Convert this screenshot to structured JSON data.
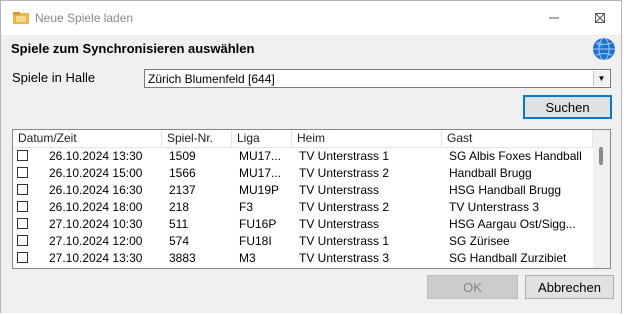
{
  "window": {
    "title": "Neue Spiele laden"
  },
  "heading": "Spiele zum Synchronisieren auswählen",
  "hall": {
    "label": "Spiele in Halle",
    "selected": "Zürich Blumenfeld [644]"
  },
  "buttons": {
    "search": "Suchen",
    "ok": "OK",
    "cancel": "Abbrechen"
  },
  "table": {
    "columns": [
      "Datum/Zeit",
      "Spiel-Nr.",
      "Liga",
      "Heim",
      "Gast"
    ],
    "rows": [
      {
        "checked": false,
        "datetime": "26.10.2024 13:30",
        "nr": "1509",
        "liga": "MU17...",
        "heim": "TV Unterstrass 1",
        "gast": "SG Albis Foxes Handball"
      },
      {
        "checked": false,
        "datetime": "26.10.2024 15:00",
        "nr": "1566",
        "liga": "MU17...",
        "heim": "TV Unterstrass 2",
        "gast": "Handball Brugg"
      },
      {
        "checked": false,
        "datetime": "26.10.2024 16:30",
        "nr": "2137",
        "liga": "MU19P",
        "heim": "TV Unterstrass",
        "gast": "HSG Handball Brugg"
      },
      {
        "checked": false,
        "datetime": "26.10.2024 18:00",
        "nr": "218",
        "liga": "F3",
        "heim": "TV Unterstrass 2",
        "gast": "TV Unterstrass 3"
      },
      {
        "checked": false,
        "datetime": "27.10.2024 10:30",
        "nr": "511",
        "liga": "FU16P",
        "heim": "TV Unterstrass",
        "gast": "HSG Aargau Ost/Sigg..."
      },
      {
        "checked": false,
        "datetime": "27.10.2024 12:00",
        "nr": "574",
        "liga": "FU18I",
        "heim": "TV Unterstrass 1",
        "gast": "SG Zürisee"
      },
      {
        "checked": false,
        "datetime": "27.10.2024 13:30",
        "nr": "3883",
        "liga": "M3",
        "heim": "TV Unterstrass 3",
        "gast": "SG Handball Zurzibiet"
      }
    ]
  },
  "icons": {
    "app": "folder-icon",
    "globe": "globe-icon",
    "minimize": "minimize-icon",
    "maximize": "maximize-icon",
    "close": "close-icon"
  }
}
